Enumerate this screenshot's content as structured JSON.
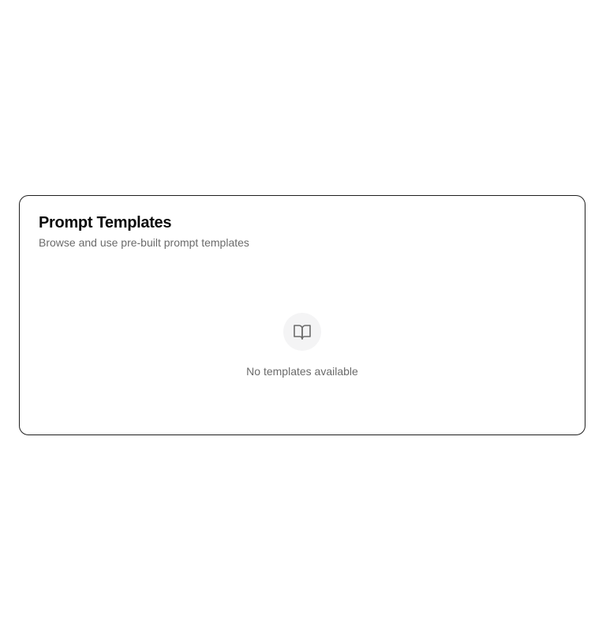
{
  "card": {
    "title": "Prompt Templates",
    "subtitle": "Browse and use pre-built prompt templates"
  },
  "empty_state": {
    "icon": "book-open-icon",
    "message": "No templates available"
  },
  "colors": {
    "border": "#1f1f1f",
    "title": "#0a0a0a",
    "muted_text": "#6b6b6b",
    "icon_bg": "#f4f4f5",
    "icon_stroke": "#6b6b6b"
  }
}
